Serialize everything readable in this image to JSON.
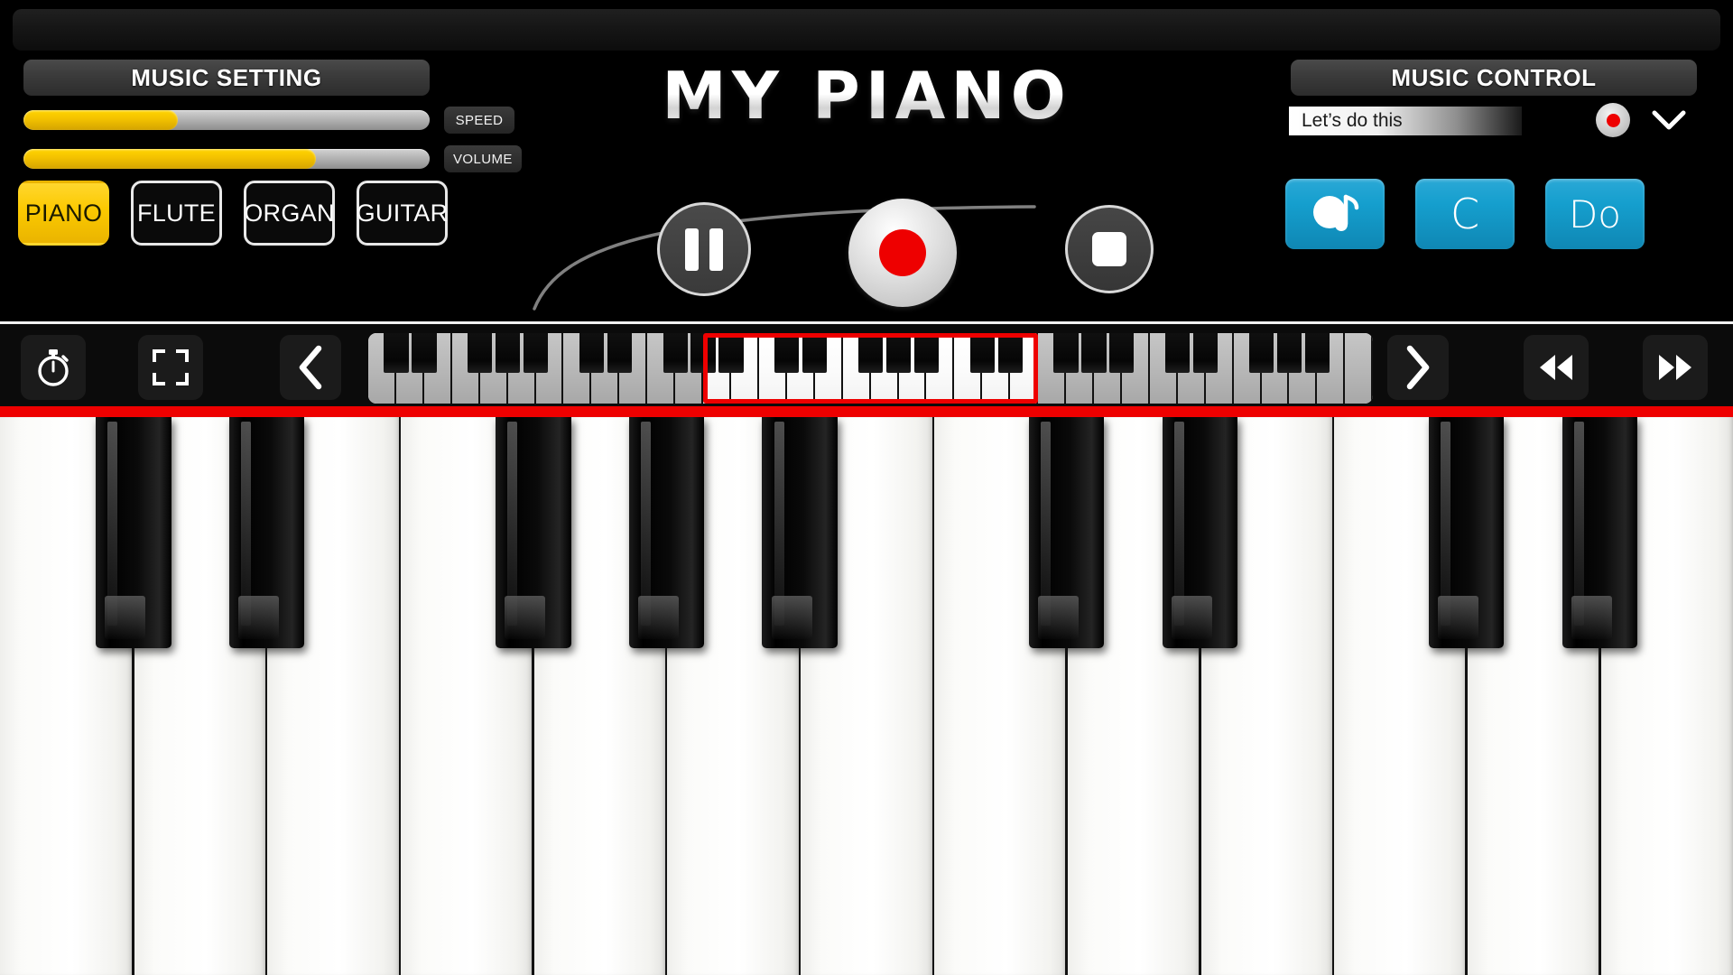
{
  "app": {
    "title": "MY PIANO"
  },
  "music_setting": {
    "title": "MUSIC SETTING",
    "sliders": [
      {
        "label": "SPEED",
        "value": 38
      },
      {
        "label": "VOLUME",
        "value": 72
      }
    ],
    "instruments": [
      {
        "label": "PIANO",
        "active": true
      },
      {
        "label": "FLUTE",
        "active": false
      },
      {
        "label": "ORGAN",
        "active": false
      },
      {
        "label": "GUITAR",
        "active": false
      }
    ]
  },
  "transport": {
    "pause_label": "pause",
    "record_label": "record",
    "stop_label": "stop"
  },
  "music_control": {
    "title": "MUSIC CONTROL",
    "song_name": "Let’s do this",
    "rec_indicator_label": "rec",
    "dropdown_label": "expand",
    "buttons": [
      {
        "label": "",
        "icon": "music-note-icon",
        "name": "songs-button"
      },
      {
        "label": "C",
        "icon": "letter-c-icon",
        "name": "note-letter-button"
      },
      {
        "label": "Do",
        "icon": "solfege-do-icon",
        "name": "note-solfege-button"
      }
    ]
  },
  "toolbar": {
    "timer_label": "timer",
    "fullscreen_label": "fullscreen",
    "prev_label": "previous octave",
    "next_label": "next octave",
    "rewind_label": "rewind",
    "forward_label": "fast forward",
    "mini_keyboard": {
      "white_keys": 36,
      "selected_start": 12,
      "selected_count": 12,
      "black_pattern": [
        0,
        1,
        3,
        4,
        5
      ]
    }
  },
  "keyboard": {
    "white_keys": 13,
    "black_pattern": [
      0,
      1,
      3,
      4,
      5
    ]
  },
  "colors": {
    "accent_yellow": "#fbc900",
    "accent_blue": "#159fce",
    "record_red": "#ee0000",
    "divider_red": "#ee0000",
    "background": "#000000"
  }
}
